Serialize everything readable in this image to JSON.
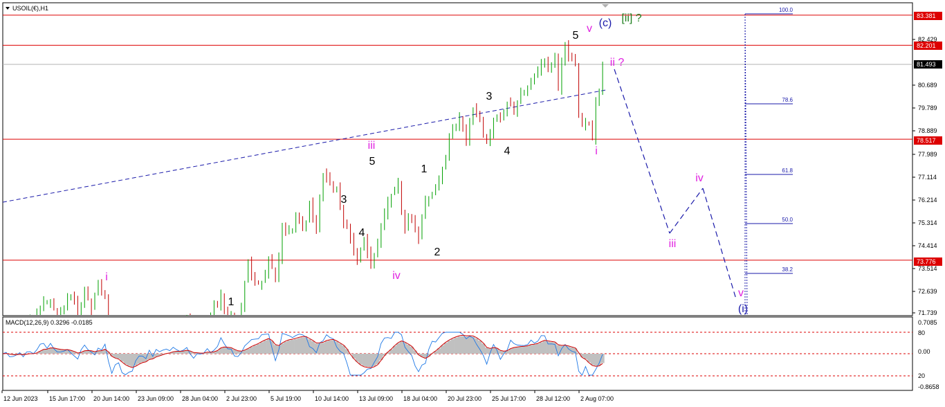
{
  "symbol_title": "USOIL(€),H1",
  "macd_title": "MACD(12,26,9) 0.3296 -0.0185",
  "colors": {
    "bull": "#00a000",
    "bear": "#c00000",
    "hline": "#dd0000",
    "fib": "#1a1aaa",
    "wave_black": "#000000",
    "wave_magenta": "#e020e0",
    "wave_blue": "#1a1aaa",
    "wave_green": "#208020",
    "macd_hist": "#c0c0c0",
    "macd_main": "#1e78e6",
    "macd_signal": "#d00000",
    "current_price_bg": "#000000"
  },
  "price_axis": {
    "ticks": [
      "82.429",
      "80.689",
      "79.789",
      "78.889",
      "77.989",
      "77.114",
      "76.214",
      "75.314",
      "74.414",
      "73.514",
      "72.639",
      "71.739"
    ],
    "current_price": "81.493",
    "hlines": [
      "83.381",
      "82.201",
      "78.517",
      "73.776"
    ]
  },
  "macd_axis": {
    "ticks": [
      "0.7085",
      "80",
      "0.00",
      "20",
      "-0.8658"
    ]
  },
  "time_axis": [
    "12 Jun 2023",
    "15 Jun 17:00",
    "20 Jun 14:00",
    "23 Jun 09:00",
    "28 Jun 04:00",
    "2 Jul 23:00",
    "5 Jul 19:00",
    "10 Jul 14:00",
    "13 Jul 09:00",
    "18 Jul 04:00",
    "20 Jul 23:00",
    "25 Jul 17:00",
    "28 Jul 12:00",
    "2 Aug 07:00"
  ],
  "fib_levels": [
    "100.0",
    "78.6",
    "61.8",
    "50.0",
    "38.2"
  ],
  "wave_labels": {
    "w1_low": "1",
    "w3": "3",
    "w4": "4",
    "w5": "5",
    "iii": "iii",
    "iv_low": "iv",
    "w1b": "1",
    "w2b": "2",
    "w3b": "3",
    "w4b": "4",
    "w5b": "5",
    "v_top": "v",
    "c_top": "(c)",
    "ii_green": "[ii] ?",
    "i_pink_left": "i",
    "i_pink_right": "i",
    "ii_pink": "ii ?",
    "iii_proj": "iii",
    "iv_proj": "iv",
    "v_proj": "v",
    "i_blue": "(i)"
  },
  "chart_data": {
    "type": "candlestick",
    "title": "USOIL(€),H1",
    "timeframe": "H1",
    "y_range": [
      71.3,
      84.0
    ],
    "x_labels": [
      "12 Jun 2023",
      "15 Jun 17:00",
      "20 Jun 14:00",
      "23 Jun 09:00",
      "28 Jun 04:00",
      "2 Jul 23:00",
      "5 Jul 19:00",
      "10 Jul 14:00",
      "13 Jul 09:00",
      "18 Jul 04:00",
      "20 Jul 23:00",
      "25 Jul 17:00",
      "28 Jul 12:00",
      "2 Aug 07:00"
    ],
    "price_path": [
      [
        0,
        71.2
      ],
      [
        8,
        71.3
      ],
      [
        14,
        72.3
      ],
      [
        16,
        71.5
      ],
      [
        20,
        72.5
      ],
      [
        22,
        71.6
      ],
      [
        24,
        72.6
      ],
      [
        26,
        71.8
      ],
      [
        28,
        72.9
      ],
      [
        30,
        72.2
      ],
      [
        32,
        70.9
      ],
      [
        40,
        70.5
      ],
      [
        52,
        71.2
      ],
      [
        54,
        71.7
      ],
      [
        56,
        70.8
      ],
      [
        60,
        71.3
      ],
      [
        64,
        72.4
      ],
      [
        66,
        71.6
      ],
      [
        68,
        71.3
      ],
      [
        70,
        72.0
      ],
      [
        72,
        73.7
      ],
      [
        74,
        73.0
      ],
      [
        76,
        72.8
      ],
      [
        78,
        73.8
      ],
      [
        80,
        73.0
      ],
      [
        82,
        75.0
      ],
      [
        84,
        74.8
      ],
      [
        86,
        75.5
      ],
      [
        88,
        75.0
      ],
      [
        90,
        75.9
      ],
      [
        92,
        75.0
      ],
      [
        94,
        77.2
      ],
      [
        96,
        76.7
      ],
      [
        98,
        76.5
      ],
      [
        100,
        75.3
      ],
      [
        102,
        74.6
      ],
      [
        104,
        73.9
      ],
      [
        106,
        74.5
      ],
      [
        108,
        73.8
      ],
      [
        110,
        74.3
      ],
      [
        112,
        75.5
      ],
      [
        114,
        76.4
      ],
      [
        116,
        76.9
      ],
      [
        117,
        75.5
      ],
      [
        118,
        75.1
      ],
      [
        120,
        75.6
      ],
      [
        122,
        74.6
      ],
      [
        124,
        76.0
      ],
      [
        126,
        76.5
      ],
      [
        128,
        77.0
      ],
      [
        130,
        78.0
      ],
      [
        132,
        79.0
      ],
      [
        134,
        79.3
      ],
      [
        136,
        78.4
      ],
      [
        138,
        79.8
      ],
      [
        140,
        79.2
      ],
      [
        142,
        78.3
      ],
      [
        144,
        79.4
      ],
      [
        146,
        79.3
      ],
      [
        148,
        80.0
      ],
      [
        150,
        79.5
      ],
      [
        152,
        80.2
      ],
      [
        154,
        80.6
      ],
      [
        156,
        81.0
      ],
      [
        158,
        81.6
      ],
      [
        160,
        81.3
      ],
      [
        162,
        81.8
      ],
      [
        163,
        80.6
      ],
      [
        165,
        82.3
      ],
      [
        166,
        81.7
      ],
      [
        168,
        81.5
      ],
      [
        169,
        79.5
      ],
      [
        170,
        78.9
      ],
      [
        171,
        79.3
      ],
      [
        172,
        79.1
      ],
      [
        173,
        78.5
      ],
      [
        174,
        79.8
      ],
      [
        175,
        80.6
      ],
      [
        176,
        81.5
      ],
      [
        177,
        81.4
      ]
    ],
    "last_price": 81.493,
    "horizontal_lines": [
      83.381,
      82.201,
      78.517,
      73.776
    ],
    "trendline": [
      [
        71.0,
        76.05
      ],
      [
        81.3,
        80.45
      ]
    ],
    "projection_path": [
      [
        81.6,
        null
      ],
      [
        75.5,
        null
      ],
      [
        77.0,
        null
      ],
      [
        71.8,
        null
      ]
    ],
    "fib_levels": [
      {
        "label": "100.0",
        "value": 83.5
      },
      {
        "label": "78.6",
        "value": 80.0
      },
      {
        "label": "61.8",
        "value": 77.2
      },
      {
        "label": "50.0",
        "value": 75.2
      },
      {
        "label": "38.2",
        "value": 73.2
      }
    ],
    "macd": {
      "params": "12,26,9",
      "main": 0.3296,
      "signal": -0.0185,
      "y_range": [
        -0.8658,
        0.7085
      ],
      "levels": [
        80,
        0.0,
        20
      ]
    }
  }
}
